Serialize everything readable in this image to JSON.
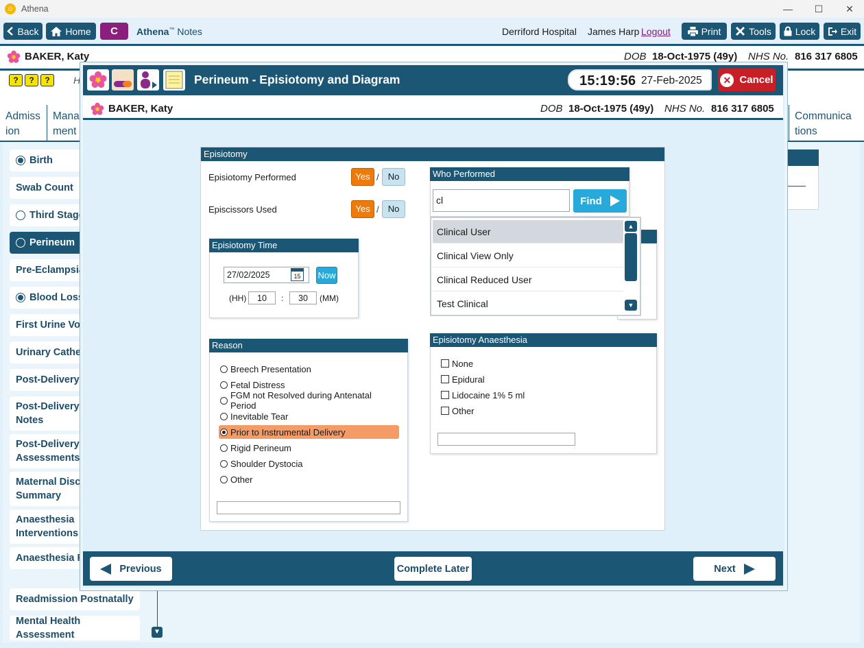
{
  "window": {
    "title": "Athena",
    "controls": [
      "—",
      "☐",
      "✕"
    ]
  },
  "toolbar": {
    "back_label": "Back",
    "home_label": "Home",
    "c_label": "C",
    "app_name": "Athena",
    "app_tm": "™",
    "app_suffix": "Notes",
    "hospital": "Derriford Hospital",
    "user": "James Harp",
    "logout_label": "Logout",
    "print_label": "Print",
    "tools_label": "Tools",
    "lock_label": "Lock",
    "exit_label": "Exit"
  },
  "patient": {
    "name": "BAKER, Katy",
    "dob_label": "DOB",
    "dob": "18-Oct-1975 (49y)",
    "nhs_label": "NHS No.",
    "nhs": "816 317 6805"
  },
  "background": {
    "row_letter": "H",
    "small_icons": [
      "?",
      "?",
      "?"
    ],
    "tabs": [
      {
        "label": "Admiss ion"
      },
      {
        "label": "Mana ment"
      },
      {
        "label": "Communica tions"
      }
    ],
    "sidebar": [
      {
        "label": "Birth",
        "radio": "on"
      },
      {
        "label": "Swab Count",
        "radio": "none"
      },
      {
        "label": "Third Stage",
        "radio": "off"
      },
      {
        "label": "Perineum",
        "radio": "off",
        "active": true
      },
      {
        "label": "Pre-Eclampsia",
        "radio": "none"
      },
      {
        "label": "Blood Loss",
        "radio": "on"
      },
      {
        "label": "First Urine Voi",
        "radio": "none"
      },
      {
        "label": "Urinary Cathe",
        "radio": "none"
      },
      {
        "label": "Post-Delivery",
        "radio": "none"
      },
      {
        "label": "Post-Delivery Notes",
        "radio": "none"
      },
      {
        "label": "Post-Delivery Assessments",
        "radio": "none"
      },
      {
        "label": "Maternal Disc Summary",
        "radio": "none"
      },
      {
        "label": "Anaesthesia Interventions",
        "radio": "none"
      },
      {
        "label": "Anaesthesia F",
        "radio": "none"
      },
      {
        "label": "Readmission Postnatally",
        "radio": "none"
      },
      {
        "label": "Mental Health Assessment",
        "radio": "none"
      }
    ]
  },
  "modal": {
    "title": "Perineum - Episiotomy and Diagram",
    "time": "15:19:56",
    "date": "27-Feb-2025",
    "cancel_label": "Cancel"
  },
  "episiotomy": {
    "section_title": "Episiotomy",
    "performed_label": "Episiotomy Performed",
    "scissors_label": "Episcissors Used",
    "yes_label": "Yes",
    "no_label": "No",
    "slash": "/",
    "performed_value": "Yes",
    "scissors_value": "Yes"
  },
  "episiotomy_time": {
    "title": "Episiotomy Time",
    "date_value": "27/02/2025",
    "calendar_day": "15",
    "now_label": "Now",
    "hh_label": "(HH)",
    "hh_value": "10",
    "colon": ":",
    "mm_value": "30",
    "mm_label": "(MM)"
  },
  "who_performed": {
    "title": "Who Performed",
    "search_value": "cl",
    "find_label": "Find",
    "dropdown": [
      {
        "label": "Clinical User",
        "highlighted": true
      },
      {
        "label": "Clinical View Only"
      },
      {
        "label": "Clinical Reduced User"
      },
      {
        "label": "Test Clinical"
      }
    ]
  },
  "reason": {
    "title": "Reason",
    "options": [
      {
        "label": "Breech Presentation",
        "selected": false
      },
      {
        "label": "Fetal Distress",
        "selected": false
      },
      {
        "label": "FGM not Resolved during Antenatal Period",
        "selected": false
      },
      {
        "label": "Inevitable Tear",
        "selected": false
      },
      {
        "label": "Prior to Instrumental Delivery",
        "selected": true
      },
      {
        "label": "Rigid Perineum",
        "selected": false
      },
      {
        "label": "Shoulder Dystocia",
        "selected": false
      },
      {
        "label": "Other",
        "selected": false
      }
    ],
    "other_text": ""
  },
  "anaesthesia": {
    "title": "Episiotomy Anaesthesia",
    "options": [
      {
        "label": "None",
        "checked": false
      },
      {
        "label": "Epidural",
        "checked": false
      },
      {
        "label": "Lidocaine 1% 5 ml",
        "checked": false
      },
      {
        "label": "Other",
        "checked": false
      }
    ],
    "other_text": ""
  },
  "footer": {
    "previous_label": "Previous",
    "complete_later_label": "Complete Later",
    "next_label": "Next"
  },
  "colors": {
    "primary": "#1b5674",
    "accent_orange": "#ef7a0c",
    "selected_row": "#f59b65",
    "cancel_red": "#c81f26",
    "find_blue": "#27a9d9"
  }
}
